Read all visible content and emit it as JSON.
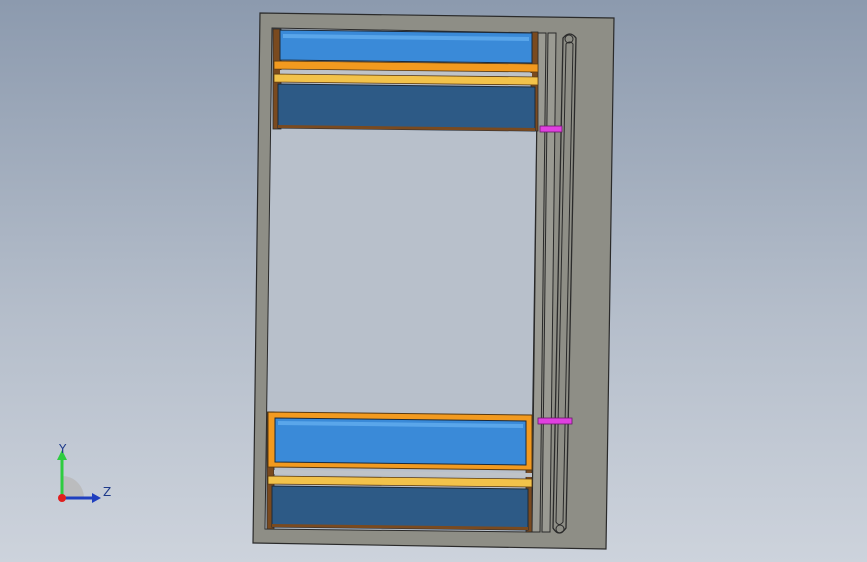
{
  "view": {
    "background_top": "#8c9aae",
    "background_bottom": "#cdd3dc"
  },
  "model": {
    "frame_color": "#8e8e86",
    "frame_edge": "#2a2a2a",
    "brown": "#7a4a1f",
    "orange": "#f29a1f",
    "yellow": "#f2c24a",
    "blue_light": "#3a8ad8",
    "blue_dark": "#2d5a86",
    "magenta": "#e040e0"
  },
  "triad": {
    "y_label": "Y",
    "z_label": "Z",
    "y_color": "#2ecc40",
    "z_color": "#1f3fbf",
    "origin_color": "#e01e1e"
  }
}
